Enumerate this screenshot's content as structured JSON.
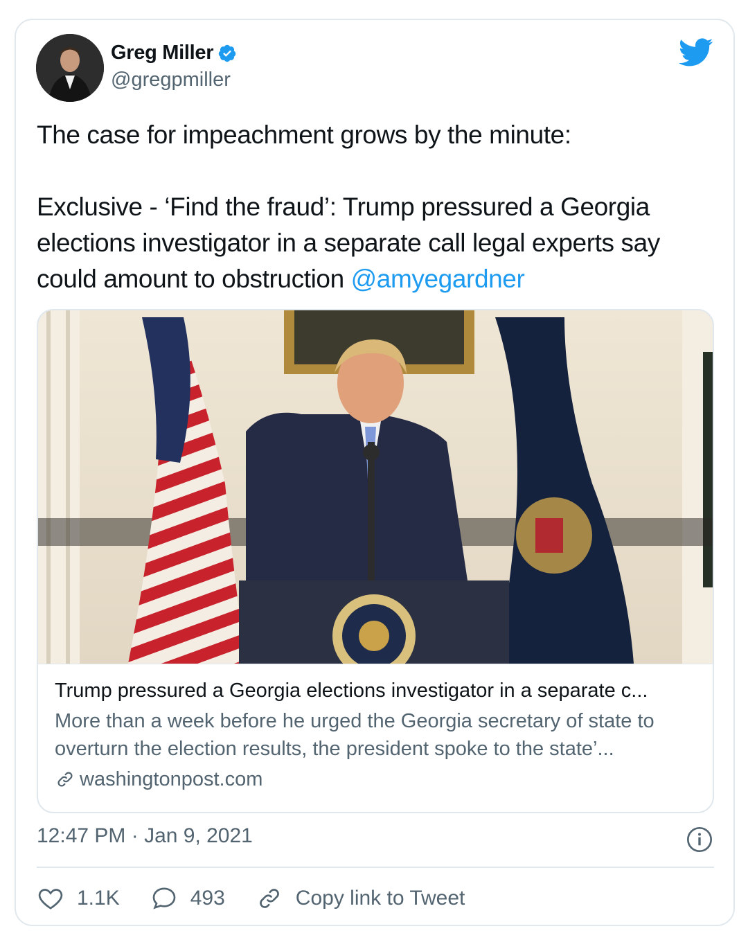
{
  "author": {
    "name": "Greg Miller",
    "handle": "@gregpmiller",
    "verified": true
  },
  "tweet": {
    "line1": "The case for impeachment grows by the minute:",
    "line2": "Exclusive - ‘Find the fraud’: Trump pressured a Georgia elections investigator in a separate call legal experts say could amount to obstruction ",
    "mention": "@amyegardner"
  },
  "link_card": {
    "title": "Trump pressured a Georgia elections investigator in a separate c...",
    "description": "More than a week before he urged the Georgia secretary of state to overturn the election results, the president spoke to the state’...",
    "domain": "washingtonpost.com"
  },
  "meta": {
    "timestamp": "12:47 PM · Jan 9, 2021"
  },
  "actions": {
    "likes": "1.1K",
    "replies": "493",
    "copy_link": "Copy link to Tweet"
  },
  "colors": {
    "accent": "#1d9bf0",
    "text": "#0f1419",
    "secondary": "#536471",
    "border": "#e1e8ed"
  },
  "icons": [
    "verified-badge-icon",
    "twitter-bird-icon",
    "link-icon",
    "info-icon",
    "heart-icon",
    "reply-icon",
    "copy-link-icon"
  ]
}
